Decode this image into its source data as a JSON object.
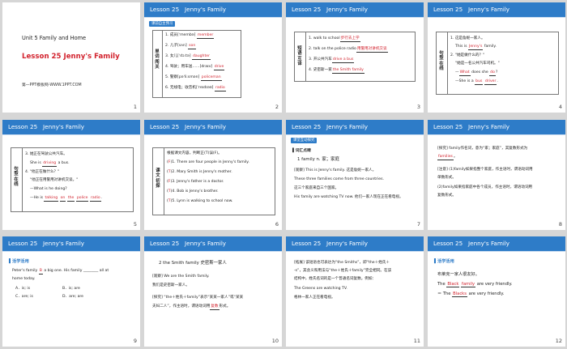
{
  "header": "Lesson 25   Jenny's Family",
  "cover": {
    "unit": "Unit 5  Family and Home",
    "title": "Lesson 25 Jenny's Family",
    "site": "第一PPT模板网-WWW.1PPT.COM"
  },
  "page_numbers": [
    "1",
    "2",
    "3",
    "4",
    "5",
    "6",
    "7",
    "8",
    "9",
    "10",
    "11",
    "12"
  ],
  "s2": {
    "tag": "课前自主预习",
    "side": "单词闯关",
    "items": [
      {
        "pre": "1. 成员[ˈmembə]",
        "ans": "member",
        "post": ""
      },
      {
        "pre": "2. 儿子[sʌn]",
        "ans": "son",
        "post": ""
      },
      {
        "pre": "3. 女儿[ˈdɔːtə]",
        "ans": "daughter",
        "post": ""
      },
      {
        "pre": "4. 驾驶；用车送……[draɪv]",
        "ans": "drive",
        "post": ""
      },
      {
        "pre": "5. 警察[pəˈliːsmən]",
        "ans": "policeman",
        "post": ""
      },
      {
        "pre": "6. 无线电；收音机[ˈreɪdɪəʊ]",
        "ans": "radio",
        "post": ""
      }
    ]
  },
  "s3": {
    "side": "短语互译",
    "items": [
      {
        "pre": "1. walk to school",
        "ans": "步行去上学",
        "post": ""
      },
      {
        "pre": "2. talk on the police radio",
        "ans": "用警用对讲机交谈",
        "post": ""
      },
      {
        "pre": "3. 开公共汽车",
        "ans": "drive a bus",
        "post": ""
      },
      {
        "pre": "4. 史密斯一家",
        "ans": "the Smith family",
        "post": ""
      }
    ]
  },
  "s4": {
    "side": "句型在线",
    "l1": "1. 这是詹妮一家人。",
    "l2pre": "This is",
    "l2ans": "Jenny's",
    "l2post": "family.",
    "l3": "2. \"她是做什么的？\"",
    "l4": "\"她是一名公共汽车司机。\"",
    "l5pre": "—",
    "l5ans1": "What",
    "l5mid1": "does",
    "l5mid2": "she",
    "l5ans2": "do",
    "l5post": "?",
    "l6pre": "—She is",
    "l6mid": "a",
    "l6ans": "bus",
    "l6ans2": "driver",
    "l6post": "."
  },
  "s5": {
    "side": "句型在线",
    "l1": "3. 她正在驾驶公共汽车。",
    "l2pre": "She is",
    "l2ans": "driving",
    "l2post": "a bus.",
    "l3": "4. \"他正在做什么？\"",
    "l4": "\"他正在用警用对讲机交谈。\"",
    "l5": "—What is he doing?",
    "l6pre": "—He is",
    "w1": "talking",
    "w2": "on",
    "w3": "the",
    "w4": "police",
    "w5": "radio",
    "l6post": "."
  },
  "s6": {
    "side": "课文初探",
    "intro": "根据课文内容，判断正(T)误(F)。",
    "items": [
      {
        "mark": "F",
        "text": ")1. There are four people in Jenny's family."
      },
      {
        "mark": "T",
        "text": ")2. Mary Smith is Jenny's mother."
      },
      {
        "mark": "F",
        "text": ")3. Jenny's father is a doctor."
      },
      {
        "mark": "T",
        "text": ")4. Bob is Jenny's brother."
      },
      {
        "mark": "T",
        "text": ")5. Lynn is walking to school now."
      }
    ]
  },
  "s7": {
    "tag": "课堂互动探究",
    "sub": "词汇点睛",
    "head": "1   family n. 家；家庭",
    "l1": "[观察] This is Jenny's family. 这是詹妮一家人。",
    "l2": "These three families come from three countries.",
    "l3": "这三个家庭来自三个国家。",
    "l4": "His family are watching TV now. 他们一家人现在正在看电视。"
  },
  "s8": {
    "l1a": "[探究] family作名词，意为“家；家庭”，其复数形式为",
    "ans1": "families",
    "l2a": "[注意] (1)family如果指整个家庭，作主语时，谓语动词用",
    "l2b": "单数形式。",
    "l3a": "(2)family如果指家庭中各个成员，作主语时，谓语动词用",
    "l3b": "复数形式。"
  },
  "s9": {
    "bullet": "活学活用",
    "l1pre": "Peter's family",
    "ans": "B",
    "l1post": "a big one. His family ________ all at",
    "l2": "home today.",
    "optA": "A．is; is",
    "optB": "B．is; are",
    "optC": "C．are; is",
    "optD": "D．are; are"
  },
  "s10": {
    "head": "2   the Smith family 史密斯一家人",
    "l1": "[观察] We are the Smith family.",
    "l2": "我们是史密斯一家人。",
    "l3": "[探究] “the＋姓氏＋family”表示“某某一家人”或“某某",
    "l4pre": "夫妇二人”，作主语时，谓语动词用",
    "ans": "复数",
    "l4post": "形式。"
  },
  "s11": {
    "l1": "[拓展] 该短语也可表达为“the Smiths”，即“the＋姓氏＋",
    "l2": "-s”，其含义和用法与“the＋姓氏＋family”完全相同。在该",
    "l3": "结构中，姓氏名词的是一个普通名词复数。例如：",
    "l4": "The Greens are watching TV.",
    "l5": "格林一家人正在看电视。"
  },
  "s12": {
    "bullet": "活学活用",
    "l1": "布莱克一家人很友好。",
    "l2pre": "The",
    "a1": "Black",
    "a2": "family",
    "l2post": "are very friendly.",
    "l3pre": "＝ The",
    "a3": "Blacks",
    "l3post": "are very friendly."
  }
}
